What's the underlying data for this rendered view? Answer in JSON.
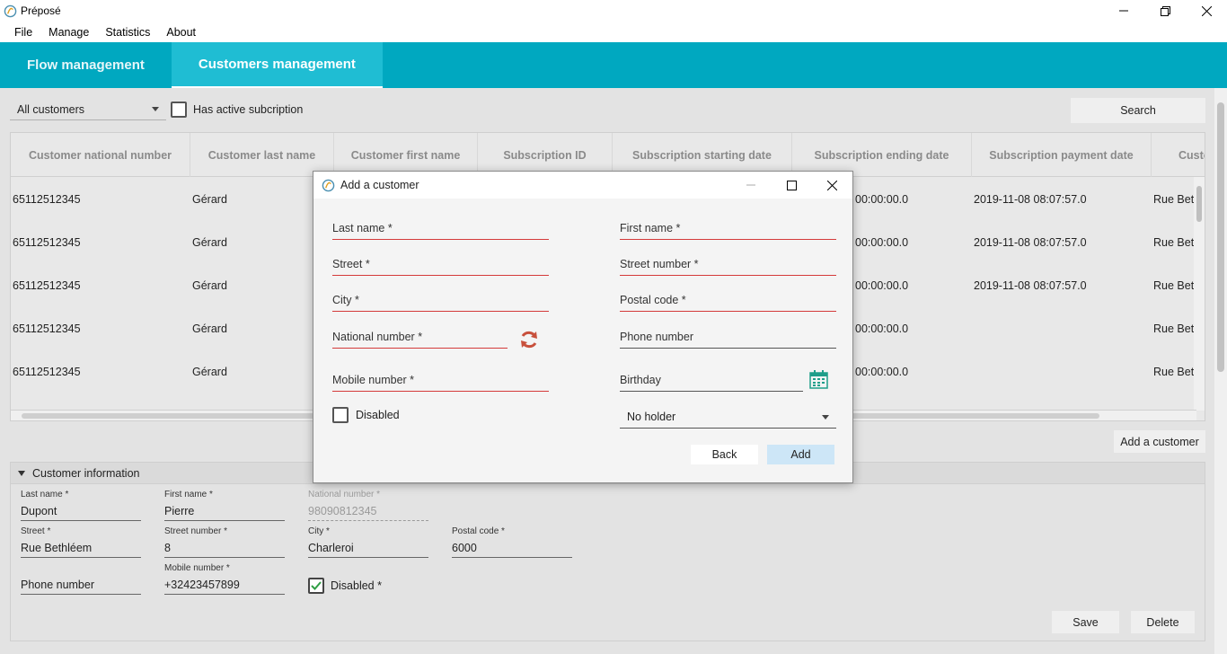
{
  "window": {
    "title": "Préposé"
  },
  "menu": [
    "File",
    "Manage",
    "Statistics",
    "About"
  ],
  "tabs": [
    {
      "label": "Flow management",
      "active": false
    },
    {
      "label": "Customers management",
      "active": true
    }
  ],
  "filter": {
    "selected": "All customers",
    "checkbox_label": "Has active subcription",
    "checkbox_checked": false,
    "search_label": "Search"
  },
  "table": {
    "columns": [
      "Customer national number",
      "Customer last name",
      "Customer first name",
      "Subscription ID",
      "Subscription starting date",
      "Subscription ending date",
      "Subscription payment date",
      "Custo"
    ],
    "rows": [
      {
        "national": "65112512345",
        "last": "Gérard",
        "ending": "00:00:00.0",
        "payment": "2019-11-08 08:07:57.0",
        "street": "Rue Beth"
      },
      {
        "national": "65112512345",
        "last": "Gérard",
        "ending": "00:00:00.0",
        "payment": "2019-11-08 08:07:57.0",
        "street": "Rue Beth"
      },
      {
        "national": "65112512345",
        "last": "Gérard",
        "ending": "00:00:00.0",
        "payment": "2019-11-08 08:07:57.0",
        "street": "Rue Beth"
      },
      {
        "national": "65112512345",
        "last": "Gérard",
        "ending": "00:00:00.0",
        "payment": "",
        "street": "Rue Beth"
      },
      {
        "national": "65112512345",
        "last": "Gérard",
        "ending": "00:00:00.0",
        "payment": "",
        "street": "Rue Beth"
      }
    ]
  },
  "add_customer_label": "Add a customer",
  "info_panel": {
    "title": "Customer information",
    "fields": {
      "last_name": {
        "label": "Last name *",
        "value": "Dupont"
      },
      "first_name": {
        "label": "First name *",
        "value": "Pierre"
      },
      "national_number": {
        "label": "National number *",
        "value": "98090812345"
      },
      "street": {
        "label": "Street *",
        "value": "Rue Bethléem"
      },
      "street_number": {
        "label": "Street number *",
        "value": "8"
      },
      "city": {
        "label": "City *",
        "value": "Charleroi"
      },
      "postal_code": {
        "label": "Postal code *",
        "value": "6000"
      },
      "phone_number": {
        "label": "",
        "value": "Phone number"
      },
      "mobile_number": {
        "label": "Mobile number *",
        "value": "+32423457899"
      }
    },
    "disabled_label": "Disabled *",
    "disabled_checked": true,
    "save_label": "Save",
    "delete_label": "Delete"
  },
  "dialog": {
    "title": "Add a customer",
    "last_name": "Last name *",
    "first_name": "First name *",
    "street": "Street *",
    "street_number": "Street number *",
    "city": "City *",
    "postal_code": "Postal code *",
    "national_number": "National number *",
    "phone_number": "Phone number",
    "mobile_number": "Mobile number *",
    "birthday": "Birthday",
    "disabled_label": "Disabled",
    "holder_selected": "No holder",
    "back_label": "Back",
    "add_label": "Add"
  },
  "colors": {
    "accent": "#00a8c0",
    "required_line": "#d43a3a",
    "refresh_icon": "#c8503c",
    "calendar_icon": "#1f9e8a"
  }
}
